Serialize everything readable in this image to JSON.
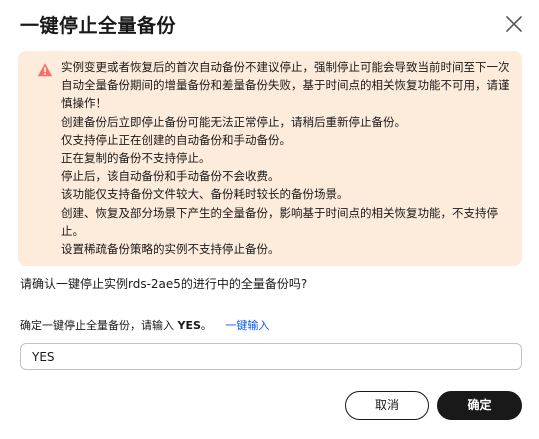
{
  "dialog": {
    "title": "一键停止全量备份",
    "close_icon": "close-icon"
  },
  "warning": {
    "icon": "warning-triangle-icon",
    "icon_color": "#f66f6a",
    "background": "#fdebdb",
    "lines": [
      "实例变更或者恢复后的首次自动备份不建议停止，强制停止可能会导致当前时间至下一次自动全量备份期间的增量备份和差量备份失败，基于时间点的相关恢复功能不可用，请谨慎操作！",
      "创建备份后立即停止备份可能无法正常停止，请稍后重新停止备份。",
      "仅支持停止正在创建的自动备份和手动备份。",
      "正在复制的备份不支持停止。",
      "停止后，该自动备份和手动备份不会收费。",
      "该功能仅支持备份文件较大、备份耗时较长的备份场景。",
      "创建、恢复及部分场景下产生的全量备份，影响基于时间点的相关恢复功能，不支持停止。",
      "设置稀疏备份策略的实例不支持停止备份。"
    ]
  },
  "confirm": {
    "question": "请确认一键停止实例rds-2ae5的进行中的全量备份吗?",
    "label_prefix": "确定一键停止全量备份，请输入",
    "keyword": "YES",
    "label_suffix": "。",
    "quick_input": "一键输入",
    "input_value": "YES"
  },
  "buttons": {
    "cancel": "取消",
    "ok": "确定"
  },
  "colors": {
    "link": "#0a59f7",
    "primary_button": "#191919"
  }
}
